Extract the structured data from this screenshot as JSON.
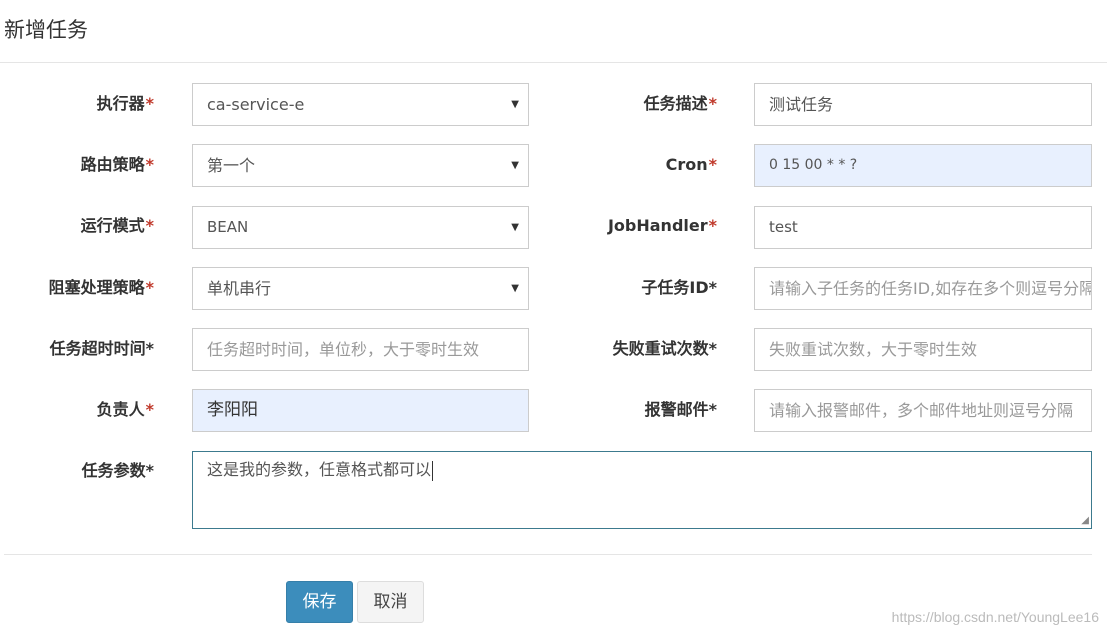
{
  "modal": {
    "title": "新增任务"
  },
  "form": {
    "executor": {
      "label": "执行器",
      "value": "ca-service-e"
    },
    "job_desc": {
      "label": "任务描述",
      "value": "测试任务"
    },
    "route_strategy": {
      "label": "路由策略",
      "value": "第一个"
    },
    "cron": {
      "label": "Cron",
      "value": "0 15 00 * * ?"
    },
    "run_mode": {
      "label": "运行模式",
      "value": "BEAN"
    },
    "job_handler": {
      "label": "JobHandler",
      "value": "test"
    },
    "block_strategy": {
      "label": "阻塞处理策略",
      "value": "单机串行"
    },
    "child_job_id": {
      "label": "子任务ID",
      "placeholder": "请输入子任务的任务ID,如存在多个则逗号分隔"
    },
    "timeout": {
      "label": "任务超时时间",
      "placeholder": "任务超时时间，单位秒，大于零时生效"
    },
    "fail_retry": {
      "label": "失败重试次数",
      "placeholder": "失败重试次数，大于零时生效"
    },
    "author": {
      "label": "负责人",
      "value": "李阳阳"
    },
    "alarm_email": {
      "label": "报警邮件",
      "placeholder": "请输入报警邮件，多个邮件地址则逗号分隔"
    },
    "job_param": {
      "label": "任务参数",
      "value": "这是我的参数，任意格式都可以"
    },
    "required_mark": "*"
  },
  "buttons": {
    "save": "保存",
    "cancel": "取消"
  },
  "watermark": "https://blog.csdn.net/YoungLee16",
  "colors": {
    "primary": "#3c8dbc",
    "required": "#c0392b",
    "autofill": "#e8f0fe"
  }
}
